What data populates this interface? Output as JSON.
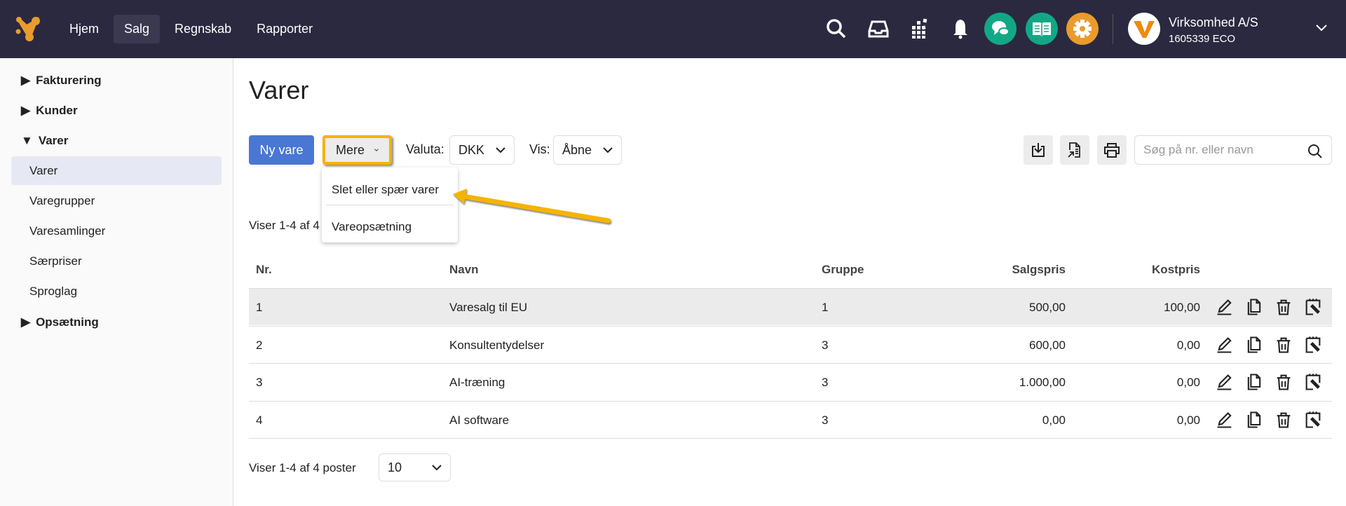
{
  "topbar": {
    "nav": [
      "Hjem",
      "Salg",
      "Regnskab",
      "Rapporter"
    ],
    "active": "Salg",
    "company_name": "Virksomhed A/S",
    "company_id": "1605339 ECO",
    "colors": {
      "chat": "#12a886",
      "book": "#12a886",
      "settings": "#eb9b2b",
      "accent": "#f6b400"
    }
  },
  "sidebar": {
    "groups": [
      {
        "label": "Fakturering"
      },
      {
        "label": "Kunder"
      },
      {
        "label": "Varer"
      },
      {
        "label": "Opsætning"
      }
    ],
    "items": [
      "Varer",
      "Varegrupper",
      "Varesamlinger",
      "Særpriser",
      "Sproglag"
    ]
  },
  "page": {
    "title": "Varer",
    "new_button": "Ny vare",
    "more_button": "Mere",
    "currency_label": "Valuta:",
    "currency_value": "DKK",
    "view_label": "Vis:",
    "view_value": "Åbne",
    "search_placeholder": "Søg på nr. eller navn",
    "showing_top": "Viser 1-4 af 4",
    "showing_bottom": "Viser 1-4 af 4 poster",
    "page_size": "10"
  },
  "dropdown": {
    "items": [
      "Slet eller spær varer",
      "Vareopsætning"
    ]
  },
  "table": {
    "headers": [
      "Nr.",
      "Navn",
      "Gruppe",
      "Salgspris",
      "Kostpris"
    ],
    "rows": [
      [
        "1",
        "Varesalg til EU",
        "1",
        "500,00",
        "100,00"
      ],
      [
        "2",
        "Konsultentydelser",
        "3",
        "600,00",
        "0,00"
      ],
      [
        "3",
        "AI-træning",
        "3",
        "1.000,00",
        "0,00"
      ],
      [
        "4",
        "AI software",
        "3",
        "0,00",
        "0,00"
      ]
    ]
  }
}
